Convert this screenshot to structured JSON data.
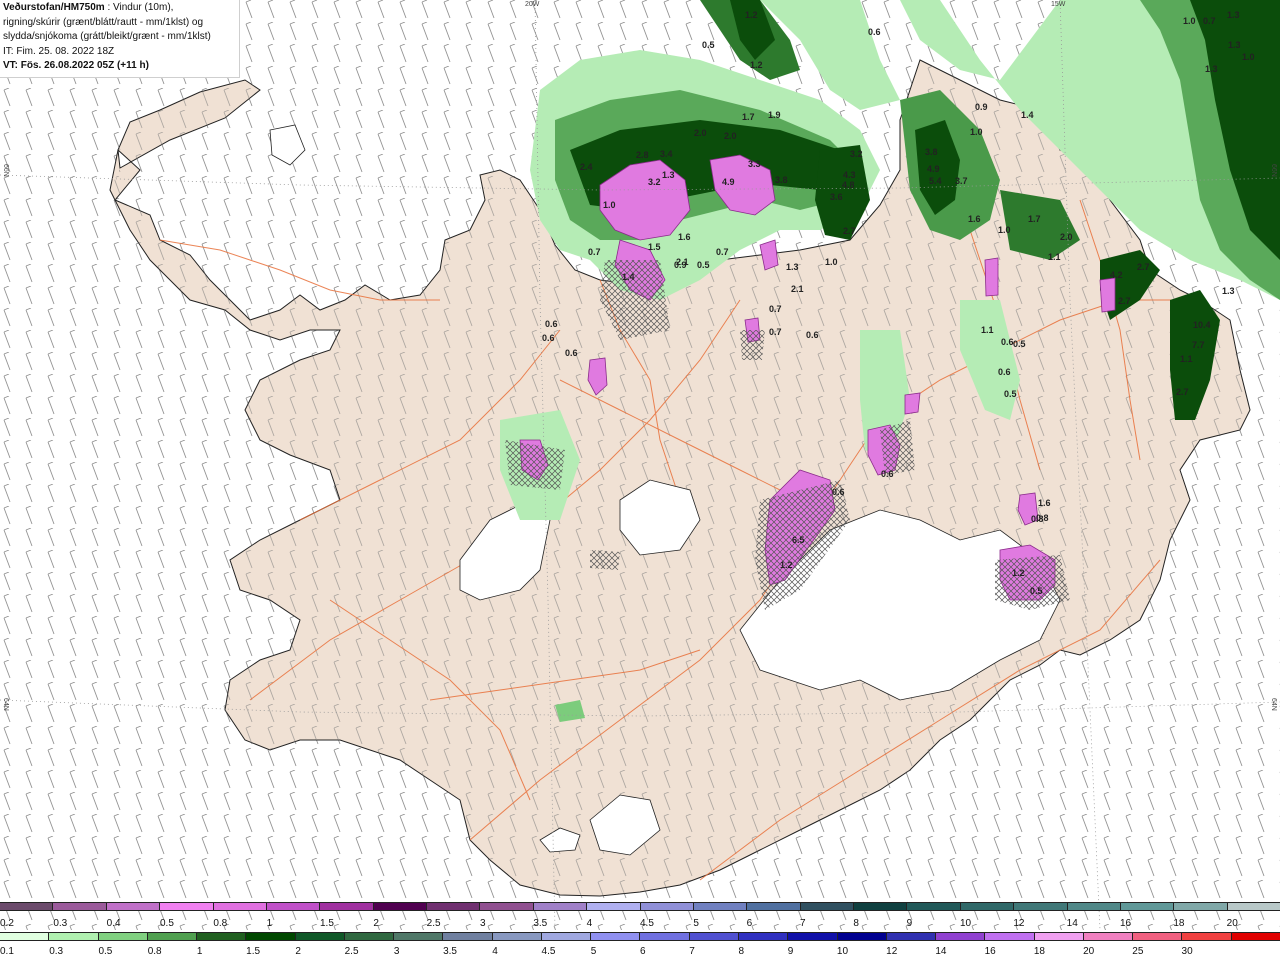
{
  "header": {
    "model_title": "Veðurstofan/HM750m",
    "description_1": " : Vindur (10m),",
    "description_2": "rigning/skúrir (grænt/blátt/rautt - mm/1klst) og",
    "description_3": "slydda/snjókoma (grátt/bleikt/grænt - mm/1klst)",
    "issue_time": "IT: Fim. 25. 08. 2022 18Z",
    "valid_time": "VT: Fös. 26.08.2022 05Z (+11 h)"
  },
  "grid_labels": {
    "top_left": "20W",
    "top_right": "15W",
    "left_upper": "66N",
    "left_lower": "64N",
    "right_upper": "66N",
    "right_lower": "64N"
  },
  "map_values": [
    "1.2",
    "0.5",
    "1.2",
    "0.6",
    "1.0",
    "0.7",
    "1.3",
    "1.3",
    "1.3",
    "1.0",
    "1.7",
    "1.9",
    "2.0",
    "2.0",
    "2.4",
    "2.8",
    "3.4",
    "3.2",
    "1.3",
    "4.9",
    "3.3",
    "3.8",
    "3.2",
    "4.3",
    "4.8",
    "3.6",
    "3.8",
    "4.9",
    "5.4",
    "3.7",
    "0.9",
    "1.0",
    "1.4",
    "1.6",
    "2.7",
    "1.0",
    "1.7",
    "2.0",
    "1.1",
    "1.0",
    "0.7",
    "1.5",
    "2.1",
    "1.4",
    "0.9",
    "0.5",
    "0.7",
    "1.3",
    "2.1",
    "1.0",
    "1.6",
    "2.7",
    "4.2",
    "2.7",
    "1.3",
    "10.4",
    "7.7",
    "1.1",
    "2.7",
    "0.6",
    "0.6",
    "0.6",
    "0.7",
    "0.7",
    "0.6",
    "1.1",
    "0.6",
    "0.5",
    "0.6",
    "0.5",
    "1.2",
    "0.6",
    "1.6",
    "0.8",
    "0.8",
    "6.5",
    "1.2",
    "0.5",
    "0.6"
  ],
  "legend": {
    "snow_colors": [
      "#6b4a6b",
      "#9b5a9b",
      "#c070c8",
      "#f080f0",
      "#e070e0",
      "#c050c8",
      "#a030a0",
      "#500050",
      "#703070",
      "#905090",
      "#a080c8",
      "#b0b0f0",
      "#9090d8",
      "#7080c0",
      "#5070a0",
      "#305060",
      "#104040",
      "#205858",
      "#306868",
      "#407878",
      "#508888",
      "#609898",
      "#80a8a8",
      "#b8c8c8"
    ],
    "snow_labels": [
      "0.2",
      "0.3",
      "0.4",
      "0.5",
      "0.8",
      "1",
      "1.5",
      "2",
      "2.5",
      "3",
      "3.5",
      "4",
      "4.5",
      "5",
      "6",
      "7",
      "8",
      "9",
      "10",
      "12",
      "14",
      "16",
      "18",
      "20",
      "25",
      "30"
    ],
    "rain_colors": [
      "#e0ffe0",
      "#b0f0b0",
      "#80d080",
      "#50a050",
      "#206020",
      "#004800",
      "#105828",
      "#306840",
      "#507868",
      "#7080a0",
      "#8898c0",
      "#a0a8e0",
      "#9090f0",
      "#7070e0",
      "#5050d0",
      "#3030c0",
      "#1010a8",
      "#000090",
      "#3030b0",
      "#9040d0",
      "#c070f0",
      "#f0a0f0",
      "#f080c0",
      "#f06080",
      "#f04040",
      "#e00000"
    ],
    "rain_labels": [
      "0.1",
      "0.3",
      "0.5",
      "0.8",
      "1",
      "1.5",
      "2",
      "2.5",
      "3",
      "3.5",
      "4",
      "4.5",
      "5",
      "6",
      "7",
      "8",
      "9",
      "10",
      "12",
      "14",
      "16",
      "18",
      "20",
      "25",
      "30"
    ]
  }
}
